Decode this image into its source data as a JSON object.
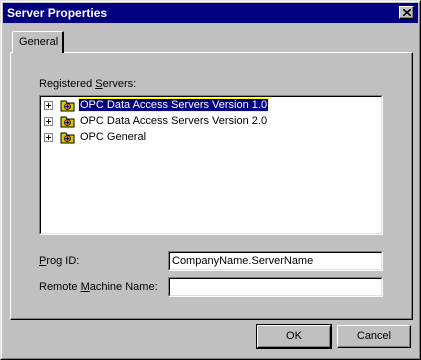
{
  "window": {
    "title": "Server Properties",
    "close_icon": "close-icon",
    "colors": {
      "titlebar": "#000080",
      "face": "#c0c0c0",
      "selection": "#000080"
    }
  },
  "tabs": [
    {
      "label": "General",
      "selected": true
    }
  ],
  "registered_servers": {
    "label_pre": "Registered ",
    "label_mnemonic": "S",
    "label_post": "ervers:",
    "items": [
      {
        "label": "OPC Data Access Servers Version 1.0",
        "icon": "server-folder-icon",
        "expander": "plus-expander-icon",
        "selected": true
      },
      {
        "label": "OPC Data Access Servers Version 2.0",
        "icon": "server-folder-icon",
        "expander": "plus-expander-icon",
        "selected": false
      },
      {
        "label": "OPC General",
        "icon": "server-folder-icon",
        "expander": "plus-expander-icon",
        "selected": false
      }
    ]
  },
  "prog_id": {
    "label_mnemonic": "P",
    "label_post": "rog ID:",
    "value": "CompanyName.ServerName"
  },
  "remote_machine": {
    "label_pre": "Remote ",
    "label_mnemonic": "M",
    "label_post": "achine Name:",
    "value": ""
  },
  "buttons": {
    "ok": "OK",
    "cancel": "Cancel"
  }
}
